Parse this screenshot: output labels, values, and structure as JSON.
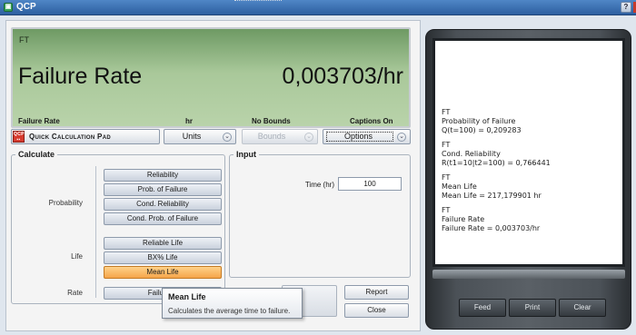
{
  "window": {
    "title": "QCP",
    "help_label": "?"
  },
  "display": {
    "top_label": "FT",
    "metric_name": "Failure Rate",
    "metric_value": "0,003703/hr",
    "footer": {
      "metric": "Failure Rate",
      "unit": "hr",
      "bounds": "No Bounds",
      "captions": "Captions On"
    }
  },
  "toolbar": {
    "quick_pad_label": "Quick Calculation Pad",
    "units_label": "Units",
    "bounds_label": "Bounds",
    "options_label": "Options"
  },
  "calculate": {
    "legend": "Calculate",
    "probability_label": "Probability",
    "life_label": "Life",
    "rate_label": "Rate",
    "buttons": {
      "reliability": "Reliability",
      "prob_failure": "Prob. of Failure",
      "cond_reliability": "Cond. Reliability",
      "cond_prob_failure": "Cond. Prob. of Failure",
      "reliable_life": "Reliable Life",
      "bx_life": "BX% Life",
      "mean_life": "Mean Life",
      "failure_rate": "Failure R"
    }
  },
  "input": {
    "legend": "Input",
    "time_label": "Time (hr)",
    "time_value": "100"
  },
  "actions": {
    "report": "Report",
    "close": "Close"
  },
  "tooltip": {
    "title": "Mean Life",
    "description": "Calculates the average time to failure."
  },
  "log": [
    {
      "tag": "FT",
      "title": "Probability of Failure",
      "result": "Q(t=100) = 0,209283"
    },
    {
      "tag": "FT",
      "title": "Cond. Reliability",
      "result": "R(t1=10|t2=100) = 0,766441"
    },
    {
      "tag": "FT",
      "title": "Mean Life",
      "result": "Mean Life = 217,179901 hr"
    },
    {
      "tag": "FT",
      "title": "Failure Rate",
      "result": "Failure Rate = 0,003703/hr"
    }
  ],
  "device_buttons": {
    "feed": "Feed",
    "print": "Print",
    "clear": "Clear"
  },
  "colors": {
    "title_bar": "#3a70b3",
    "lcd_green": "#a9c89a",
    "active_button": "#f5a54a"
  }
}
